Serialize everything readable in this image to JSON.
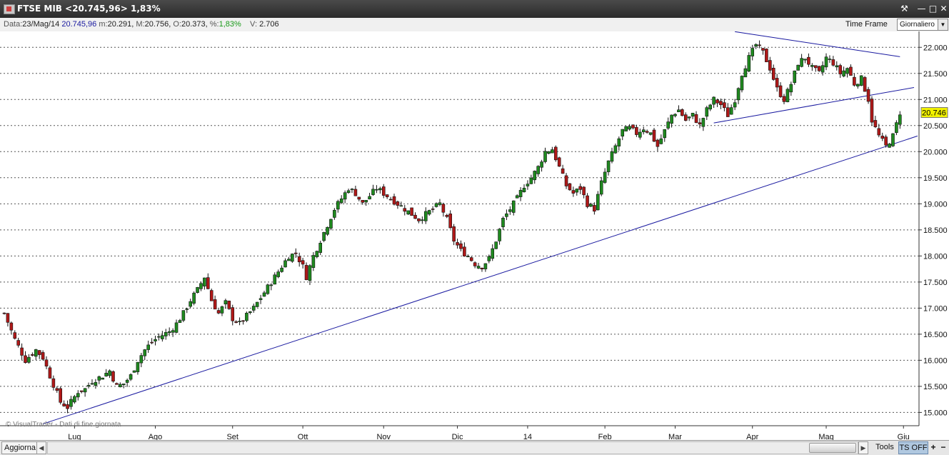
{
  "window": {
    "title": "FTSE MIB <20.745,96> 1,83%",
    "buttons": {
      "tools_glyph": "⚒",
      "minimize_glyph": "—",
      "restore_glyph": "□",
      "close_glyph": "✕"
    }
  },
  "infobar": {
    "date_label": "Data:",
    "date_value": "23/Mag/14",
    "last_value": "20.745,96",
    "min_label": "m:",
    "min_value": "20.291,",
    "max_label": "M:",
    "max_value": "20.756,",
    "open_label": "O:",
    "open_value": "20.373,",
    "pct_label": "%:",
    "pct_value": "1,83%",
    "vol_label": "V:",
    "vol_value": "2.706",
    "timeframe_label": "Time Frame",
    "timeframe_value": "Giornaliero"
  },
  "chart_data": {
    "type": "candlestick",
    "watermark": "© VisualTrader - Dati di fine giornata",
    "price_tag": "20.746",
    "ylim": [
      14800,
      22250
    ],
    "y_ticks": [
      "15.000",
      "15.500",
      "16.000",
      "16.500",
      "17.000",
      "17.500",
      "18.000",
      "18.500",
      "19.000",
      "19.500",
      "20.000",
      "20.500",
      "21.000",
      "21.500",
      "22.000"
    ],
    "y_tick_values": [
      15000,
      15500,
      16000,
      16500,
      17000,
      17500,
      18000,
      18500,
      19000,
      19500,
      20000,
      20500,
      21000,
      21500,
      22000
    ],
    "x_labels": [
      {
        "label": "Lug",
        "day": 61
      },
      {
        "label": "Ago",
        "day": 84
      },
      {
        "label": "Set",
        "day": 106
      },
      {
        "label": "Ott",
        "day": 126
      },
      {
        "label": "Nov",
        "day": 149
      },
      {
        "label": "Dic",
        "day": 170
      },
      {
        "label": "14",
        "day": 190
      },
      {
        "label": "Feb",
        "day": 212
      },
      {
        "label": "Mar",
        "day": 232
      },
      {
        "label": "Apr",
        "day": 254
      },
      {
        "label": "Mag",
        "day": 275
      },
      {
        "label": "Giu",
        "day": 297
      }
    ],
    "day_range": [
      41,
      300
    ],
    "close_path": [
      [
        41,
        16900
      ],
      [
        44,
        16400
      ],
      [
        47,
        16000
      ],
      [
        50,
        16200
      ],
      [
        52,
        16050
      ],
      [
        54,
        15700
      ],
      [
        57,
        15200
      ],
      [
        59,
        15100
      ],
      [
        62,
        15400
      ],
      [
        64,
        15450
      ],
      [
        66,
        15600
      ],
      [
        69,
        15700
      ],
      [
        71,
        15800
      ],
      [
        73,
        15500
      ],
      [
        75,
        15550
      ],
      [
        77,
        15700
      ],
      [
        79,
        16000
      ],
      [
        81,
        16200
      ],
      [
        83,
        16350
      ],
      [
        85,
        16450
      ],
      [
        88,
        16550
      ],
      [
        90,
        16700
      ],
      [
        92,
        16900
      ],
      [
        94,
        17150
      ],
      [
        96,
        17350
      ],
      [
        98,
        17600
      ],
      [
        100,
        17150
      ],
      [
        102,
        16900
      ],
      [
        104,
        17100
      ],
      [
        106,
        16800
      ],
      [
        108,
        16700
      ],
      [
        110,
        16850
      ],
      [
        112,
        17000
      ],
      [
        114,
        17200
      ],
      [
        116,
        17400
      ],
      [
        118,
        17600
      ],
      [
        120,
        17800
      ],
      [
        122,
        18000
      ],
      [
        124,
        18050
      ],
      [
        126,
        17800
      ],
      [
        127,
        17600
      ],
      [
        129,
        18000
      ],
      [
        131,
        18300
      ],
      [
        133,
        18600
      ],
      [
        135,
        18900
      ],
      [
        137,
        19100
      ],
      [
        139,
        19300
      ],
      [
        141,
        19200
      ],
      [
        143,
        19000
      ],
      [
        145,
        19150
      ],
      [
        147,
        19300
      ],
      [
        149,
        19200
      ],
      [
        151,
        19100
      ],
      [
        153,
        19000
      ],
      [
        155,
        18900
      ],
      [
        157,
        18800
      ],
      [
        159,
        18700
      ],
      [
        161,
        18800
      ],
      [
        163,
        18900
      ],
      [
        165,
        19000
      ],
      [
        167,
        18700
      ],
      [
        169,
        18300
      ],
      [
        171,
        18100
      ],
      [
        173,
        18000
      ],
      [
        175,
        17850
      ],
      [
        177,
        17800
      ],
      [
        179,
        17950
      ],
      [
        181,
        18300
      ],
      [
        183,
        18700
      ],
      [
        185,
        18900
      ],
      [
        187,
        19100
      ],
      [
        189,
        19350
      ],
      [
        191,
        19500
      ],
      [
        193,
        19700
      ],
      [
        195,
        20000
      ],
      [
        197,
        20050
      ],
      [
        199,
        19700
      ],
      [
        201,
        19350
      ],
      [
        203,
        19200
      ],
      [
        205,
        19300
      ],
      [
        207,
        19000
      ],
      [
        209,
        18900
      ],
      [
        211,
        19400
      ],
      [
        213,
        19800
      ],
      [
        215,
        20100
      ],
      [
        217,
        20400
      ],
      [
        219,
        20450
      ],
      [
        221,
        20350
      ],
      [
        223,
        20450
      ],
      [
        225,
        20350
      ],
      [
        227,
        20100
      ],
      [
        229,
        20400
      ],
      [
        231,
        20700
      ],
      [
        233,
        20800
      ],
      [
        235,
        20600
      ],
      [
        237,
        20700
      ],
      [
        239,
        20500
      ],
      [
        241,
        20800
      ],
      [
        243,
        21000
      ],
      [
        245,
        20900
      ],
      [
        247,
        20700
      ],
      [
        249,
        21000
      ],
      [
        251,
        21500
      ],
      [
        253,
        21800
      ],
      [
        255,
        22050
      ],
      [
        257,
        21900
      ],
      [
        259,
        21600
      ],
      [
        261,
        21200
      ],
      [
        263,
        21000
      ],
      [
        265,
        21300
      ],
      [
        267,
        21700
      ],
      [
        269,
        21800
      ],
      [
        271,
        21600
      ],
      [
        273,
        21500
      ],
      [
        275,
        21800
      ],
      [
        277,
        21700
      ],
      [
        279,
        21500
      ],
      [
        281,
        21600
      ],
      [
        283,
        21300
      ],
      [
        285,
        21400
      ],
      [
        287,
        21000
      ],
      [
        288,
        20600
      ],
      [
        290,
        20300
      ],
      [
        292,
        20100
      ],
      [
        294,
        20300
      ],
      [
        296,
        20750
      ]
    ],
    "trendlines": [
      {
        "name": "support-long",
        "from": [
          52,
          14780
        ],
        "to": [
          301,
          20300
        ]
      },
      {
        "name": "support-short",
        "from": [
          243,
          20550
        ],
        "to": [
          300,
          21230
        ]
      },
      {
        "name": "resistance",
        "from": [
          249,
          22300
        ],
        "to": [
          296,
          21820
        ]
      }
    ]
  }
}
